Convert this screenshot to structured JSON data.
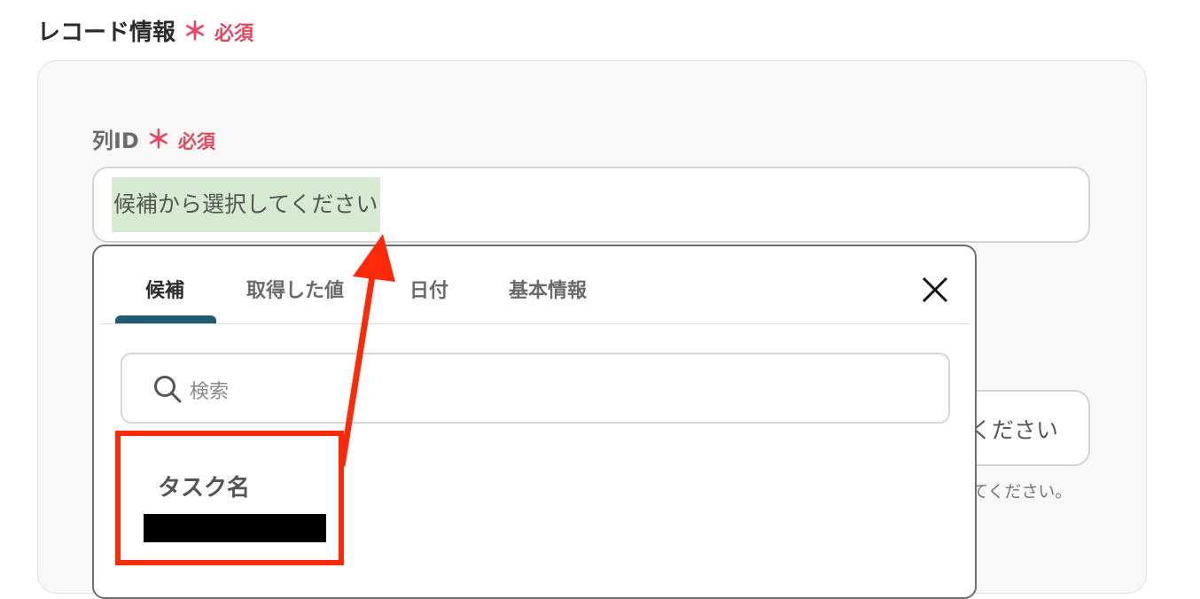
{
  "section": {
    "title": "レコード情報",
    "required_mark": "＊",
    "required_text": "必須"
  },
  "field": {
    "label": "列ID",
    "required_mark": "＊",
    "required_text": "必須",
    "placeholder": "候補から選択してください"
  },
  "background": {
    "input_partial_text": "ください",
    "help_partial_text": "てください。"
  },
  "dropdown": {
    "tabs": [
      {
        "label": "候補",
        "active": true
      },
      {
        "label": "取得した値",
        "active": false
      },
      {
        "label": "日付",
        "active": false
      },
      {
        "label": "基本情報",
        "active": false
      }
    ],
    "close_icon": "close-icon",
    "search": {
      "placeholder": "検索",
      "icon": "search-icon"
    },
    "items": [
      {
        "label": "タスク名",
        "value": "[redacted]"
      }
    ]
  },
  "colors": {
    "required": "#e4475f",
    "tab_indicator": "#1d5c73",
    "placeholder_highlight": "#d5ead0",
    "annotation": "#fd2a0a"
  }
}
